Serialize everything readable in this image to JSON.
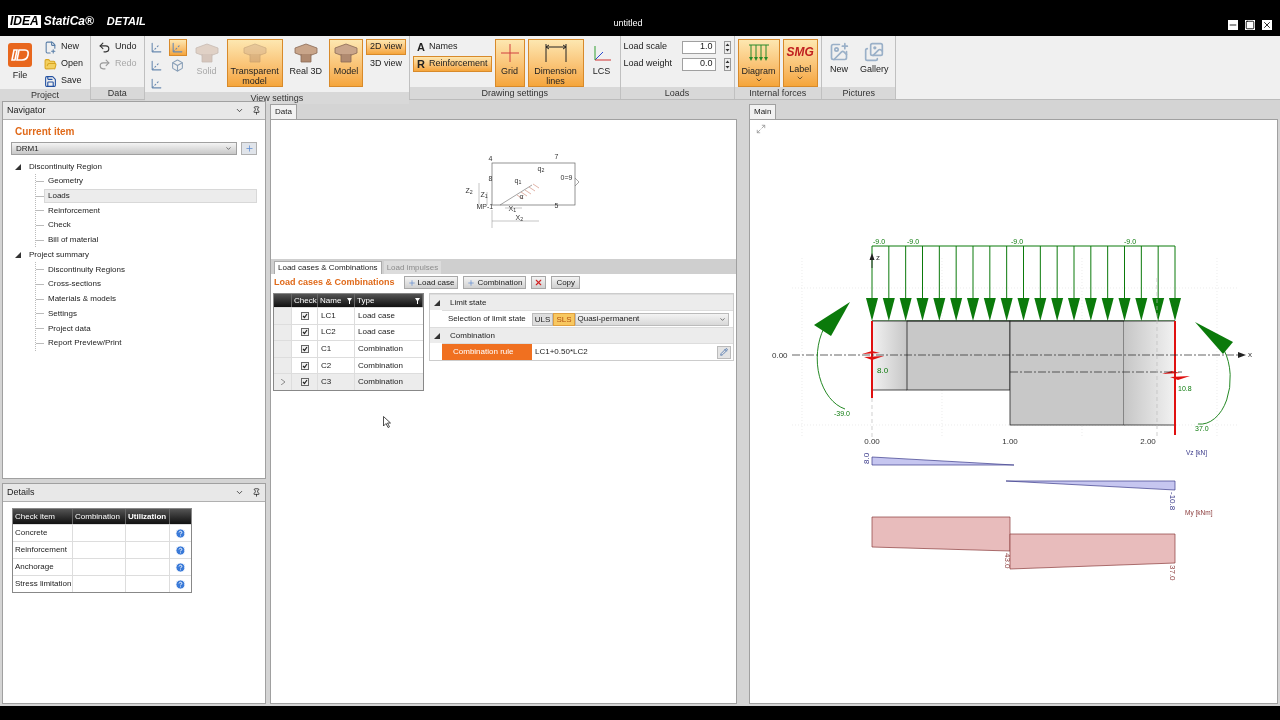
{
  "app": {
    "logo": "IDEA",
    "product": "StatiCa®",
    "module": "DETAIL"
  },
  "window": {
    "title": "untitled"
  },
  "ribbon": [
    {
      "label": "Project",
      "items": [
        {
          "kind": "big",
          "label": "File",
          "selected": false,
          "disabled": false
        },
        {
          "kind": "small",
          "label": "New",
          "selected": false,
          "disabled": false
        },
        {
          "kind": "small",
          "label": "Open",
          "selected": false,
          "disabled": false
        },
        {
          "kind": "small",
          "label": "Save",
          "selected": false,
          "disabled": false
        }
      ]
    },
    {
      "label": "Data",
      "items": [
        {
          "kind": "small",
          "label": "Undo",
          "selected": false,
          "disabled": false
        },
        {
          "kind": "small",
          "label": "Redo",
          "selected": false,
          "disabled": true
        }
      ]
    },
    {
      "label": "View settings",
      "items": [
        {
          "kind": "tool",
          "selected": false,
          "disabled": false
        },
        {
          "kind": "tool",
          "selected": false,
          "disabled": false
        },
        {
          "kind": "tool",
          "selected": false,
          "disabled": false
        },
        {
          "kind": "tool",
          "selected": true,
          "disabled": false
        },
        {
          "kind": "tool",
          "selected": false,
          "disabled": false
        },
        {
          "kind": "big",
          "label": "Solid",
          "selected": false,
          "disabled": true
        },
        {
          "kind": "big",
          "label": "Transparent model",
          "selected": true,
          "disabled": false
        },
        {
          "kind": "big",
          "label": "Real 3D",
          "selected": false,
          "disabled": false
        },
        {
          "kind": "big",
          "label": "Model",
          "selected": true,
          "disabled": false
        },
        {
          "kind": "small",
          "label": "2D view",
          "selected": true,
          "disabled": false
        },
        {
          "kind": "small",
          "label": "3D view",
          "selected": false,
          "disabled": false
        }
      ]
    },
    {
      "label": "Drawing settings",
      "items": [
        {
          "kind": "small",
          "label": "Names",
          "glyph": "A",
          "selected": false,
          "disabled": false
        },
        {
          "kind": "small",
          "label": "Reinforcement",
          "glyph": "R",
          "selected": true,
          "disabled": false
        },
        {
          "kind": "big",
          "label": "Grid",
          "selected": true,
          "disabled": false
        },
        {
          "kind": "big",
          "label": "Dimension lines",
          "selected": true,
          "disabled": false
        },
        {
          "kind": "big",
          "label": "LCS",
          "selected": false,
          "disabled": false
        }
      ]
    },
    {
      "label": "Loads",
      "items": [
        {
          "kind": "spin",
          "label": "Load scale",
          "value": "1.0",
          "selected": false,
          "disabled": false
        },
        {
          "kind": "spin",
          "label": "Load weight",
          "value": "0.0",
          "selected": false,
          "disabled": false
        }
      ]
    },
    {
      "label": "Internal forces",
      "items": [
        {
          "kind": "menu",
          "label": "Diagram",
          "selected": true,
          "disabled": false
        },
        {
          "kind": "menu",
          "label": "Label",
          "glyph": "SMG",
          "selected": true,
          "disabled": false
        }
      ]
    },
    {
      "label": "Pictures",
      "items": [
        {
          "kind": "big",
          "label": "New",
          "selected": false,
          "disabled": false
        },
        {
          "kind": "big",
          "label": "Gallery",
          "selected": false,
          "disabled": false
        }
      ]
    }
  ],
  "navigator": {
    "title": "Navigator",
    "current_label": "Current item",
    "current_value": "DRM1",
    "tree": [
      {
        "label": "Discontinuity Region",
        "expanded": true,
        "selected": false,
        "children": [
          {
            "label": "Geometry",
            "selected": false
          },
          {
            "label": "Loads",
            "selected": true
          },
          {
            "label": "Reinforcement",
            "selected": false
          },
          {
            "label": "Check",
            "selected": false
          },
          {
            "label": "Bill of material",
            "selected": false
          }
        ]
      },
      {
        "label": "Project summary",
        "expanded": true,
        "selected": false,
        "children": [
          {
            "label": "Discontinuity Regions",
            "selected": false
          },
          {
            "label": "Cross-sections",
            "selected": false
          },
          {
            "label": "Materials & models",
            "selected": false
          },
          {
            "label": "Settings",
            "selected": false
          },
          {
            "label": "Project data",
            "selected": false
          },
          {
            "label": "Report Preview/Print",
            "selected": false
          }
        ]
      }
    ]
  },
  "details": {
    "title": "Details",
    "columns": [
      "Check item",
      "Combination",
      "Utilization"
    ],
    "rows": [
      "Concrete",
      "Reinforcement",
      "Anchorage",
      "Stress limitation"
    ]
  },
  "data_panel": {
    "tab": "Data",
    "sketch_labels": [
      "4",
      "7",
      "8",
      "q$_{2}$",
      "q$_{1}$",
      "0=9",
      "Z$_{2}$",
      "Z$_{1}$",
      "α",
      "MP-1",
      "X$_{1}$",
      "5",
      "X$_{2}$"
    ],
    "tabs": [
      {
        "label": "Load cases & Combinations",
        "selected": true,
        "disabled": false
      },
      {
        "label": "Load impulses",
        "selected": false,
        "disabled": true
      }
    ],
    "heading": "Load cases & Combinations",
    "actions": [
      {
        "kind": "add",
        "label": "Load case"
      },
      {
        "kind": "add",
        "label": "Combination"
      },
      {
        "kind": "delete"
      },
      {
        "kind": "plain",
        "label": "Copy"
      }
    ],
    "table": {
      "columns": [
        "Check",
        "Name",
        "Type"
      ],
      "rows": [
        {
          "checked": true,
          "name": "LC1",
          "type": "Load case",
          "selected": false
        },
        {
          "checked": true,
          "name": "LC2",
          "type": "Load case",
          "selected": false
        },
        {
          "checked": true,
          "name": "C1",
          "type": "Combination",
          "selected": false
        },
        {
          "checked": true,
          "name": "C2",
          "type": "Combination",
          "selected": false
        },
        {
          "checked": true,
          "name": "C3",
          "type": "Combination",
          "selected": true
        }
      ]
    },
    "properties": [
      {
        "title": "Limit state",
        "expanded": true,
        "rows": [
          {
            "kind": "limit",
            "label": "Selection of limit state",
            "options": [
              {
                "label": "ULS",
                "selected": false
              },
              {
                "label": "SLS",
                "selected": true
              }
            ],
            "value": "Quasi-permanent",
            "selected": false
          }
        ]
      },
      {
        "title": "Combination",
        "expanded": true,
        "rows": [
          {
            "kind": "rule",
            "label": "Combination rule",
            "value": "LC1+0.50*LC2",
            "selected": true
          }
        ]
      }
    ]
  },
  "main_panel": {
    "tab": "Main",
    "diagram": {
      "loads": [
        "-9.0",
        "-9.0",
        "-9.0",
        "-9.0"
      ],
      "axis_z": "z",
      "axis_x": "x",
      "origin": "0.00",
      "reactions": [
        "8.0",
        "10.8"
      ],
      "moments": [
        "-39.0",
        "37.0"
      ],
      "x_ticks": [
        "0.00",
        "1.00",
        "2.00"
      ],
      "shear": {
        "title": "Vz [kN]",
        "values": [
          "8.0",
          "-10.8"
        ]
      },
      "bending": {
        "title": "My [kNm]",
        "values": [
          "43.0",
          "37.0"
        ]
      }
    }
  }
}
